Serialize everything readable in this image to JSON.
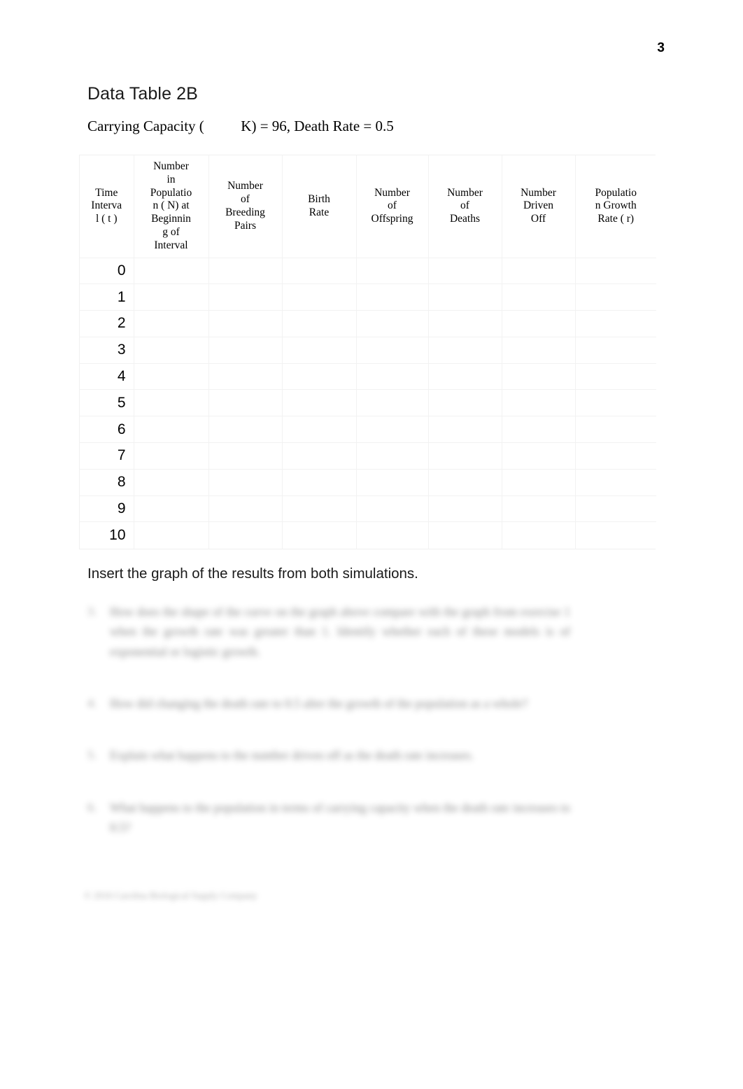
{
  "page": {
    "number": "3"
  },
  "heading": {
    "title": "Data Table 2B",
    "parameters": "Carrying Capacity (          K) = 96, Death Rate = 0.5",
    "carrying_capacity": "96",
    "death_rate": "0.5"
  },
  "table": {
    "columns": [
      {
        "key": "time",
        "label": "Time\nInterva\nl ( t )"
      },
      {
        "key": "pop",
        "label": "Number\nin\nPopulatio\nn (  N) at\nBeginnin\ng of\nInterval"
      },
      {
        "key": "breed",
        "label": "Number\nof\nBreeding\nPairs"
      },
      {
        "key": "birth",
        "label": "Birth\nRate"
      },
      {
        "key": "off",
        "label": "Number\nof\nOffspring"
      },
      {
        "key": "death",
        "label": "Number\nof\nDeaths"
      },
      {
        "key": "driven",
        "label": "Number\nDriven\nOff"
      },
      {
        "key": "rate",
        "label": "Populatio\nn Growth\nRate (    r)"
      }
    ],
    "rows": [
      {
        "time": "0",
        "pop": "",
        "breed": "",
        "birth": "",
        "off": "",
        "death": "",
        "driven": "",
        "rate": ""
      },
      {
        "time": "1",
        "pop": "",
        "breed": "",
        "birth": "",
        "off": "",
        "death": "",
        "driven": "",
        "rate": ""
      },
      {
        "time": "2",
        "pop": "",
        "breed": "",
        "birth": "",
        "off": "",
        "death": "",
        "driven": "",
        "rate": ""
      },
      {
        "time": "3",
        "pop": "",
        "breed": "",
        "birth": "",
        "off": "",
        "death": "",
        "driven": "",
        "rate": ""
      },
      {
        "time": "4",
        "pop": "",
        "breed": "",
        "birth": "",
        "off": "",
        "death": "",
        "driven": "",
        "rate": ""
      },
      {
        "time": "5",
        "pop": "",
        "breed": "",
        "birth": "",
        "off": "",
        "death": "",
        "driven": "",
        "rate": ""
      },
      {
        "time": "6",
        "pop": "",
        "breed": "",
        "birth": "",
        "off": "",
        "death": "",
        "driven": "",
        "rate": ""
      },
      {
        "time": "7",
        "pop": "",
        "breed": "",
        "birth": "",
        "off": "",
        "death": "",
        "driven": "",
        "rate": ""
      },
      {
        "time": "8",
        "pop": "",
        "breed": "",
        "birth": "",
        "off": "",
        "death": "",
        "driven": "",
        "rate": ""
      },
      {
        "time": "9",
        "pop": "",
        "breed": "",
        "birth": "",
        "off": "",
        "death": "",
        "driven": "",
        "rate": ""
      },
      {
        "time": "10",
        "pop": "",
        "breed": "",
        "birth": "",
        "off": "",
        "death": "",
        "driven": "",
        "rate": ""
      }
    ]
  },
  "instruction": "Insert the graph of the results from both simulations.",
  "questions": [
    {
      "marker": "3.",
      "text": "How does the shape of the curve on the graph above compare with the graph from exercise 1 when the growth rate was greater than 1. Identify whether each of these models is of exponential or logistic growth."
    },
    {
      "marker": "4.",
      "text": "How did changing the death rate to 0.5 alter the growth of the population as a whole?"
    },
    {
      "marker": "5.",
      "text": "Explain what happens to the number driven off as the death rate increases."
    },
    {
      "marker": "6.",
      "text": "What happens to the population in terms of carrying capacity when the death rate increases to 0.5?"
    }
  ],
  "footer": "© 2016 Carolina Biological Supply Company"
}
